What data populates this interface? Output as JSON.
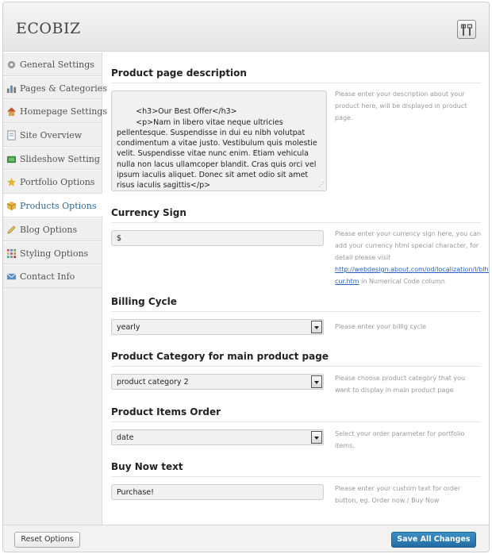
{
  "header": {
    "brand": "ECOBIZ",
    "settings_icon": "tools-icon"
  },
  "sidebar": {
    "items": [
      {
        "label": "General Settings",
        "icon": "gear-icon",
        "active": false
      },
      {
        "label": "Pages & Categories",
        "icon": "chart-icon",
        "active": false
      },
      {
        "label": "Homepage Settings",
        "icon": "home-icon",
        "active": false
      },
      {
        "label": "Site Overview",
        "icon": "document-icon",
        "active": false
      },
      {
        "label": "Slideshow Setting",
        "icon": "slideshow-icon",
        "active": false
      },
      {
        "label": "Portfolio Options",
        "icon": "star-icon",
        "active": false
      },
      {
        "label": "Products Options",
        "icon": "box-icon",
        "active": true
      },
      {
        "label": "Blog Options",
        "icon": "pencil-icon",
        "active": false
      },
      {
        "label": "Styling Options",
        "icon": "palette-icon",
        "active": false
      },
      {
        "label": "Contact Info",
        "icon": "mail-icon",
        "active": false
      }
    ]
  },
  "product_description": {
    "title": "Product page description",
    "value": "<h3>Our Best Offer</h3>\n        <p>Nam in libero vitae neque ultricies pellentesque. Suspendisse in dui eu nibh volutpat condimentum a vitae justo. Vestibulum quis molestie velit. Suspendisse vitae nunc enim. Etiam vehicula nulla non lacus ullamcoper blandit. Cras quis orci vel ipsum iaculis aliquet. Donec sit amet odio sit amet risus iaculis sagittis</p>",
    "help": "Please enter your description about your product here, will be displayed in product page."
  },
  "currency": {
    "title": "Currency Sign",
    "value": "$",
    "help_before": "Please enter your currency sign here, you can add your currency html special character, for detail please visit ",
    "help_link": "http://webdesign.about.com/od/localization/l/blhtmlcodes-cur.htm",
    "help_after": " in Numerical Code column"
  },
  "billing": {
    "title": "Billing Cycle",
    "selected": "yearly",
    "help": "Please enter your billig cycle"
  },
  "product_category": {
    "title": "Product Category for main product page",
    "selected": "product category 2",
    "help": "Please choose product category that you want to display in main product page"
  },
  "items_order": {
    "title": "Product Items Order",
    "selected": "date",
    "help": "Select your order parameter for portfolio items."
  },
  "buy_now": {
    "title": "Buy Now text",
    "value": "Purchase!",
    "help": "Please enter your custom text for order button, eg. Order now / Buy Now"
  },
  "footer": {
    "reset_label": "Reset Options",
    "save_label": "Save All Changes"
  },
  "colors": {
    "accent": "#2a6b9e",
    "save_button": "#2a78ad",
    "link": "#2a62c8"
  }
}
